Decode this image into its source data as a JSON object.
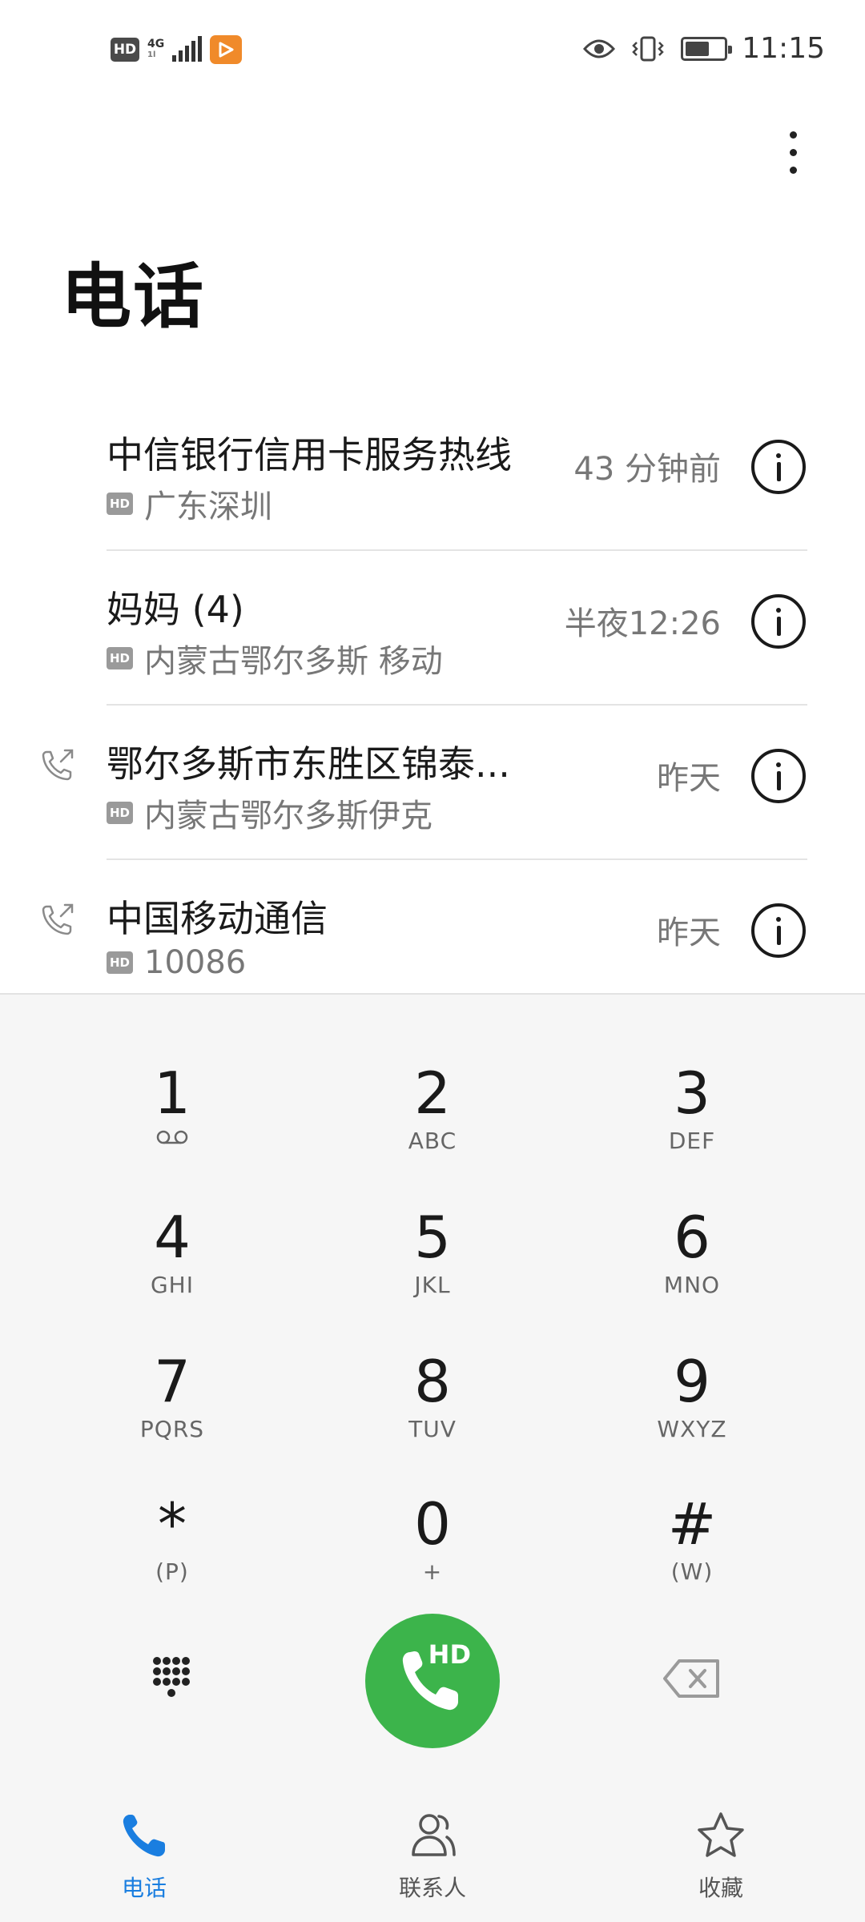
{
  "status_bar": {
    "hd": "HD",
    "network": "4G",
    "network_sub": "1l",
    "time": "11:15"
  },
  "header": {
    "title": "电话",
    "more_icon": "more-vertical-icon"
  },
  "call_log": [
    {
      "name": "中信银行信用卡服务热线",
      "hd": "HD",
      "location": "广东深圳",
      "time": "43 分钟前",
      "outgoing": false
    },
    {
      "name": "妈妈 (4)",
      "hd": "HD",
      "location": "内蒙古鄂尔多斯 移动",
      "time": "半夜12:26",
      "outgoing": false
    },
    {
      "name": "鄂尔多斯市东胜区锦泰...",
      "hd": "HD",
      "location": "内蒙古鄂尔多斯伊克",
      "time": "昨天",
      "outgoing": true
    },
    {
      "name": "中国移动通信",
      "hd": "HD",
      "location": "10086",
      "time": "昨天",
      "outgoing": true
    }
  ],
  "dialpad": {
    "keys": [
      {
        "digit": "1",
        "letters": ""
      },
      {
        "digit": "2",
        "letters": "ABC"
      },
      {
        "digit": "3",
        "letters": "DEF"
      },
      {
        "digit": "4",
        "letters": "GHI"
      },
      {
        "digit": "5",
        "letters": "JKL"
      },
      {
        "digit": "6",
        "letters": "MNO"
      },
      {
        "digit": "7",
        "letters": "PQRS"
      },
      {
        "digit": "8",
        "letters": "TUV"
      },
      {
        "digit": "9",
        "letters": "WXYZ"
      },
      {
        "digit": "*",
        "letters": "(P)"
      },
      {
        "digit": "0",
        "letters": "+"
      },
      {
        "digit": "#",
        "letters": "(W)"
      }
    ],
    "call_hd_label": "HD",
    "call_color": "#3cb44b"
  },
  "bottom_nav": {
    "items": [
      {
        "label": "电话",
        "icon": "phone-icon",
        "active": true
      },
      {
        "label": "联系人",
        "icon": "contacts-icon",
        "active": false
      },
      {
        "label": "收藏",
        "icon": "star-icon",
        "active": false
      }
    ],
    "active_color": "#1a7ee0"
  }
}
